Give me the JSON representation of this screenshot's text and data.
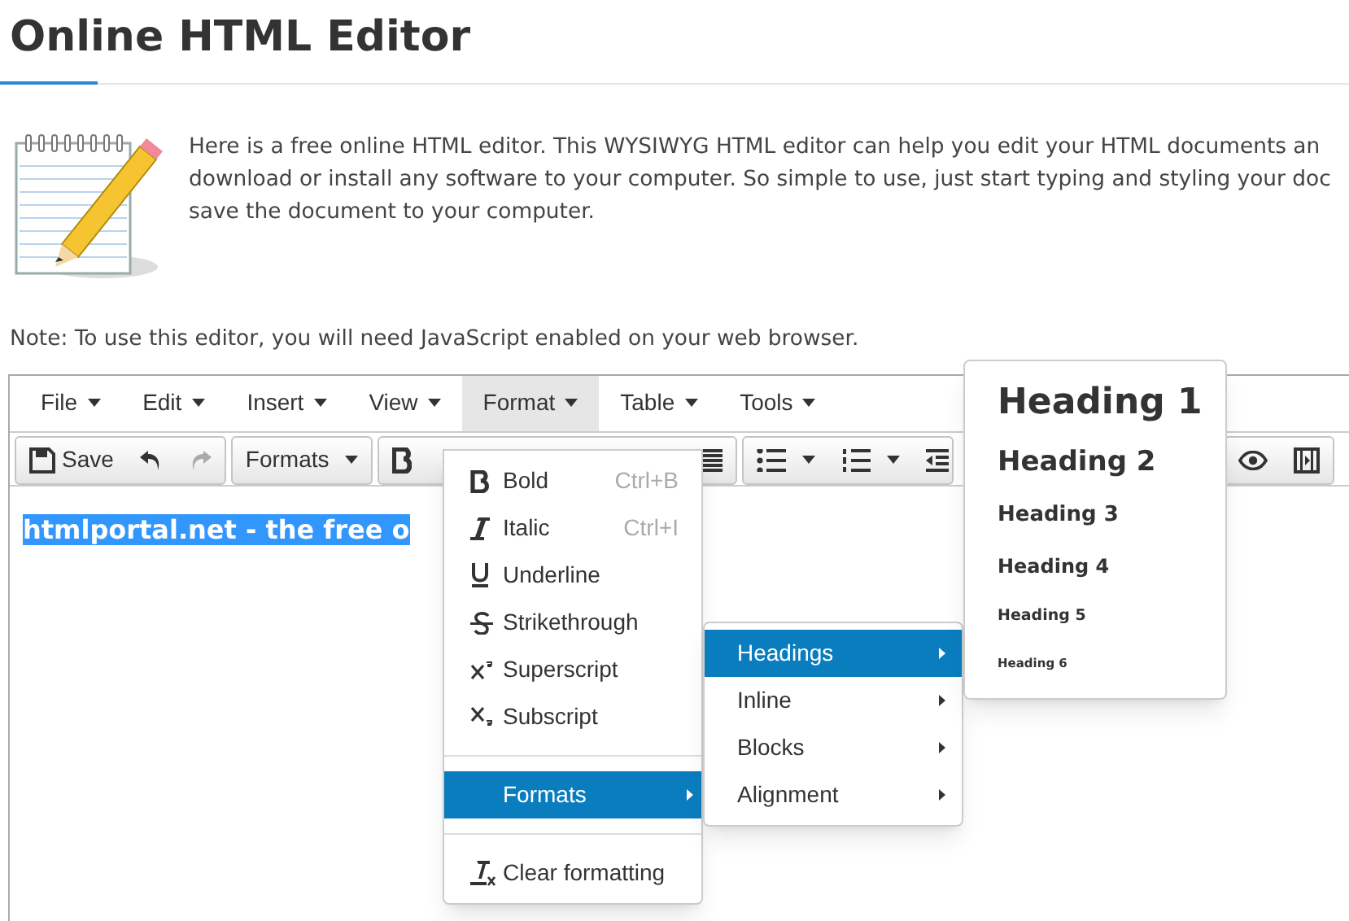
{
  "page_title": "Online HTML Editor",
  "intro_lines": [
    "Here is a free online HTML editor. This WYSIWYG HTML editor can help you edit your HTML documents an",
    "download or install any software to your computer. So simple to use, just start typing and styling your doc",
    "save the document to your computer."
  ],
  "note": "Note: To use this editor, you will need JavaScript enabled on your web browser.",
  "editor": {
    "menubar": [
      {
        "label": "File",
        "selected": false
      },
      {
        "label": "Edit",
        "selected": false
      },
      {
        "label": "Insert",
        "selected": false
      },
      {
        "label": "View",
        "selected": false
      },
      {
        "label": "Format",
        "selected": true
      },
      {
        "label": "Table",
        "selected": false
      },
      {
        "label": "Tools",
        "selected": false
      }
    ],
    "toolbar_groups": [
      [
        {
          "kind": "save",
          "label": "Save"
        },
        {
          "kind": "undo"
        },
        {
          "kind": "redo"
        }
      ],
      [
        {
          "kind": "dropdown",
          "label": "Formats"
        }
      ],
      [
        {
          "kind": "bold"
        },
        {
          "kind": "justify"
        }
      ],
      [
        {
          "kind": "bullets"
        },
        {
          "kind": "numbers"
        },
        {
          "kind": "outdent"
        }
      ],
      [
        {
          "kind": "preview"
        },
        {
          "kind": "media"
        }
      ]
    ],
    "content": "htmlportal.net - the free o",
    "format_menu": [
      {
        "kind": "bold",
        "label": "Bold",
        "shortcut": "Ctrl+B"
      },
      {
        "kind": "italic",
        "label": "Italic",
        "shortcut": "Ctrl+I"
      },
      {
        "kind": "underline",
        "label": "Underline"
      },
      {
        "kind": "strikethrough",
        "label": "Strikethrough"
      },
      {
        "kind": "superscript",
        "label": "Superscript"
      },
      {
        "kind": "subscript",
        "label": "Subscript"
      },
      {
        "kind": "separator"
      },
      {
        "kind": "submenu",
        "label": "Formats",
        "selected": true
      },
      {
        "kind": "separator"
      },
      {
        "kind": "clear",
        "label": "Clear formatting"
      }
    ],
    "formats_submenu": [
      {
        "label": "Headings",
        "selected": true
      },
      {
        "label": "Inline",
        "selected": false
      },
      {
        "label": "Blocks",
        "selected": false
      },
      {
        "label": "Alignment",
        "selected": false
      }
    ],
    "headings_menu": [
      {
        "label": "Heading 1",
        "kind": "h1"
      },
      {
        "label": "Heading 2",
        "kind": "h2"
      },
      {
        "label": "Heading 3",
        "kind": "h3"
      },
      {
        "label": "Heading 4",
        "kind": "h4"
      },
      {
        "label": "Heading 5",
        "kind": "h5"
      },
      {
        "label": "Heading 6",
        "kind": "h6"
      }
    ]
  }
}
